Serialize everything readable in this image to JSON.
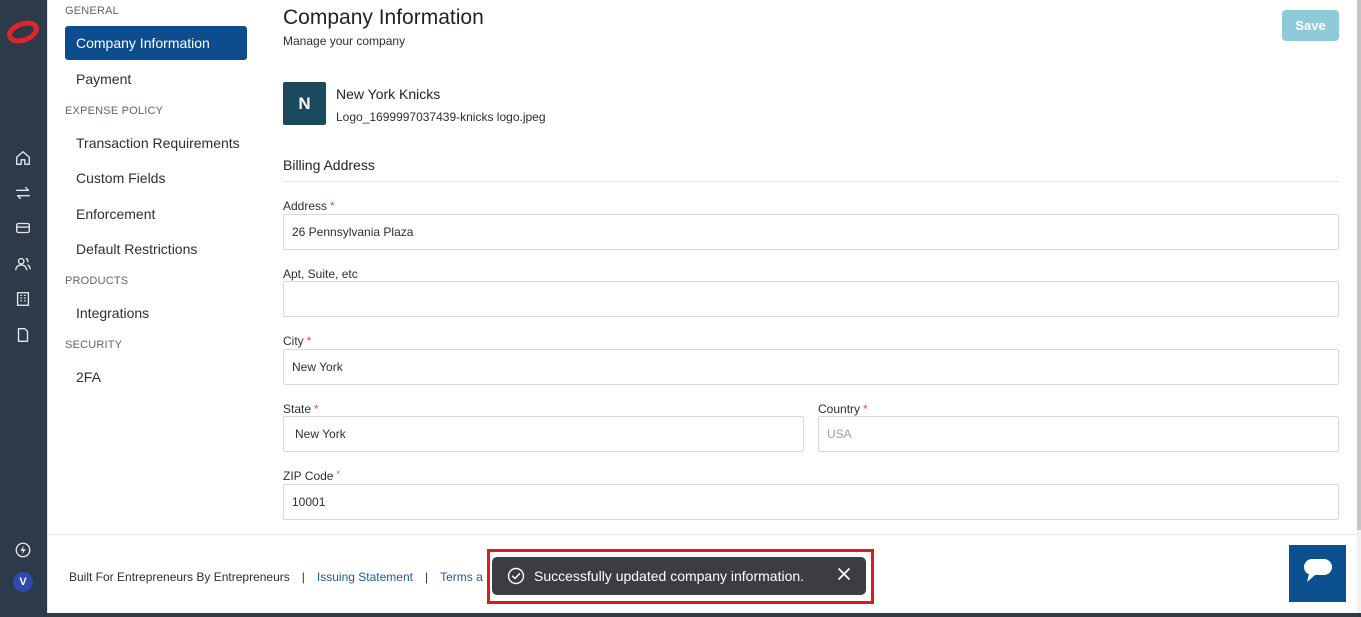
{
  "rail": {
    "icons": [
      "brand-logo-icon",
      "home-icon",
      "transfer-icon",
      "card-icon",
      "users-icon",
      "building-icon",
      "document-icon",
      "bolt-icon"
    ],
    "avatar_initial": "V"
  },
  "settings_nav": {
    "sections": {
      "general": "GENERAL",
      "expense_policy": "EXPENSE POLICY",
      "products": "PRODUCTS",
      "security": "SECURITY"
    },
    "items": {
      "company_information": "Company Information",
      "payment": "Payment",
      "transaction_requirements": "Transaction Requirements",
      "custom_fields": "Custom Fields",
      "enforcement": "Enforcement",
      "default_restrictions": "Default Restrictions",
      "integrations": "Integrations",
      "twofa": "2FA"
    },
    "active": "Company Information"
  },
  "main": {
    "title": "Company Information",
    "subtitle": "Manage your company",
    "save_label": "Save",
    "company": {
      "initial": "N",
      "name": "New York Knicks",
      "logo_file": "Logo_1699997037439-knicks logo.jpeg"
    },
    "billing_title": "Billing Address",
    "fields": {
      "address": {
        "label": "Address",
        "value": "26 Pennsylvania Plaza",
        "required": "*"
      },
      "apt": {
        "label": "Apt, Suite, etc",
        "value": ""
      },
      "city": {
        "label": "City",
        "value": "New York",
        "required": "*"
      },
      "state": {
        "label": "State",
        "value": "New York",
        "required": "*"
      },
      "country": {
        "label": "Country",
        "placeholder": "USA",
        "required": "*"
      },
      "zip": {
        "label": "ZIP Code",
        "value": "10001",
        "required": "*"
      }
    }
  },
  "footer": {
    "tagline": "Built For Entrepreneurs By Entrepreneurs",
    "separator": "|",
    "issuing_statement": "Issuing Statement",
    "terms": "Terms a"
  },
  "toast": {
    "message": "Successfully updated company information."
  },
  "colors": {
    "rail_bg": "#2d3a4a",
    "active_nav": "#0e4d8d",
    "save_button": "#8fcad8",
    "company_avatar": "#1b4a5e",
    "toast_bg": "#3b3d40",
    "highlight_border": "#e01a1a",
    "chat_button": "#0b4f8f",
    "link": "#1f5b99"
  }
}
